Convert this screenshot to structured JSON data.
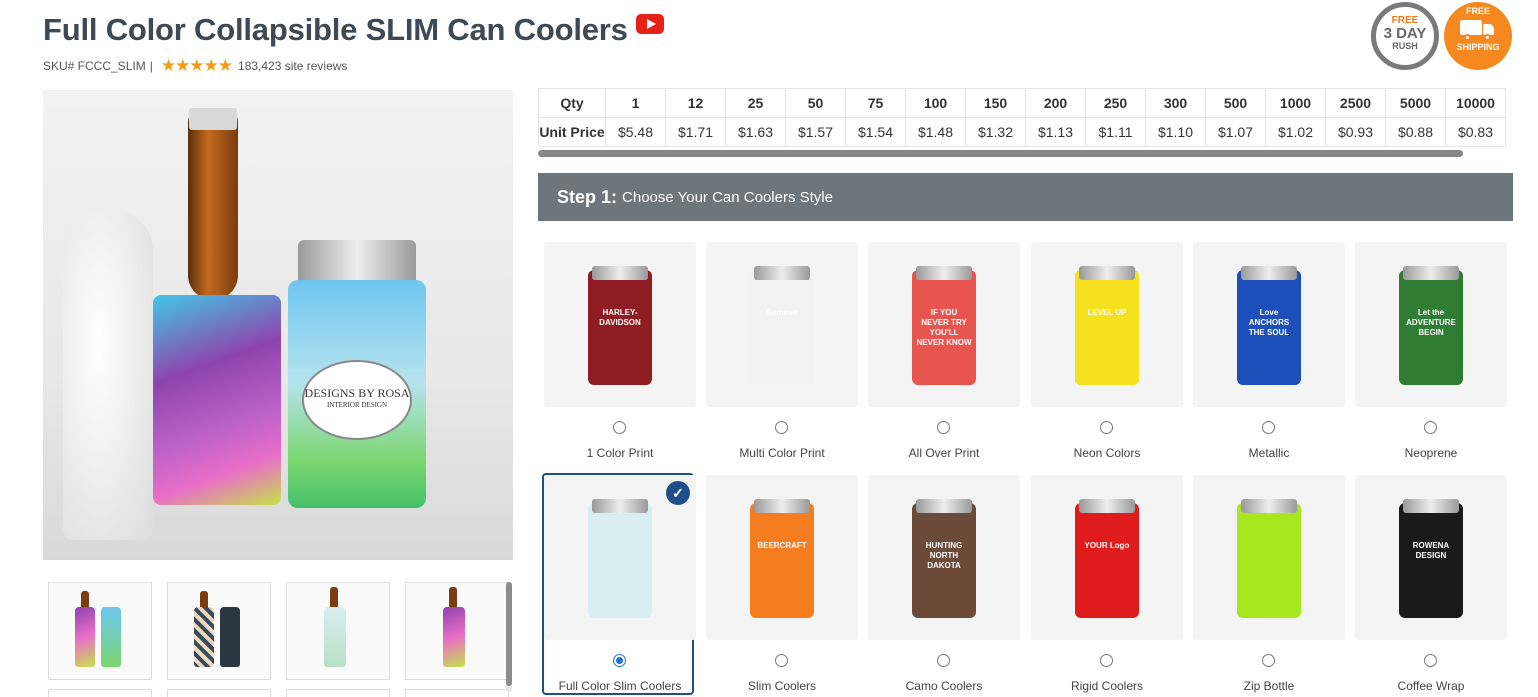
{
  "product": {
    "title": "Full Color Collapsible SLIM Can Coolers",
    "sku": "SKU# FCCC_SLIM",
    "separator": "|",
    "stars": "★★★★★",
    "reviews": "183,423 site reviews"
  },
  "badges": {
    "rush": {
      "free": "FREE",
      "line1": "3 DAY",
      "line2": "RUSH"
    },
    "shipping": {
      "free": "FREE",
      "line2": "SHIPPING"
    }
  },
  "photo": {
    "label_line1": "DESIGNS BY ROSA",
    "label_line2": "INTERIOR DESIGN"
  },
  "pricing": {
    "qty_label": "Qty",
    "price_label": "Unit Price",
    "quantities": [
      "1",
      "12",
      "25",
      "50",
      "75",
      "100",
      "150",
      "200",
      "250",
      "300",
      "500",
      "1000",
      "2500",
      "5000",
      "10000"
    ],
    "prices": [
      "$5.48",
      "$1.71",
      "$1.63",
      "$1.57",
      "$1.54",
      "$1.48",
      "$1.32",
      "$1.13",
      "$1.11",
      "$1.10",
      "$1.07",
      "$1.02",
      "$0.93",
      "$0.88",
      "$0.83"
    ]
  },
  "step": {
    "number": "Step 1:",
    "text": "Choose Your Can Coolers Style"
  },
  "styles": [
    {
      "name": "1 Color Print",
      "color": "#8e1c22",
      "art": "HARLEY-DAVIDSON"
    },
    {
      "name": "Multi Color Print",
      "color": "#f2f2f2",
      "art": "Summer"
    },
    {
      "name": "All Over Print",
      "color": "#e8554f",
      "art": "IF YOU NEVER TRY YOU'LL NEVER KNOW"
    },
    {
      "name": "Neon Colors",
      "color": "#f5e11d",
      "art": "LEVEL UP"
    },
    {
      "name": "Metallic",
      "color": "#1c4fb8",
      "art": "Love ANCHORS THE SOUL"
    },
    {
      "name": "Neoprene",
      "color": "#2e7d32",
      "art": "Let the ADVENTURE BEGIN"
    },
    {
      "name": "Full Color Slim Coolers",
      "color": "#d9eef0",
      "art": "",
      "selected": true
    },
    {
      "name": "Slim Coolers",
      "color": "#f57c1f",
      "art": "BEERCRAFT"
    },
    {
      "name": "Camo Coolers",
      "color": "#6b4a3a",
      "art": "HUNTING NORTH DAKOTA"
    },
    {
      "name": "Rigid Coolers",
      "color": "#e01b1b",
      "art": "YOUR Logo"
    },
    {
      "name": "Zip Bottle",
      "color": "#a8e620",
      "art": ""
    },
    {
      "name": "Coffee Wrap",
      "color": "#1a1a1a",
      "art": "ROWENA DESIGN"
    }
  ]
}
